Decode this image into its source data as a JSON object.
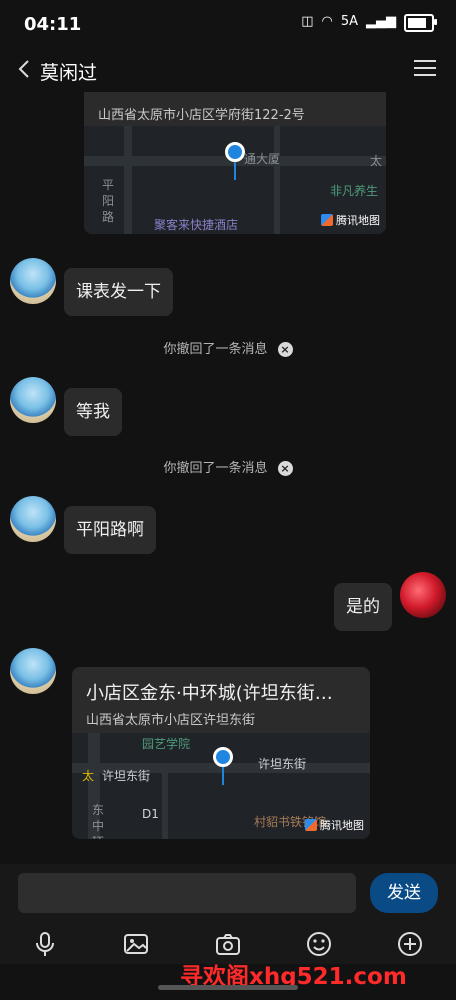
{
  "status_bar": {
    "time": "04:11",
    "network": "5A",
    "battery_level": 0.7
  },
  "header": {
    "title": "莫闲过"
  },
  "messages": {
    "map1": {
      "address": "山西省太原市小店区学府街122-2号",
      "labels": [
        "平",
        "阳",
        "路",
        "通大厦",
        "非凡养生",
        "太",
        "聚客来快捷酒店"
      ],
      "provider": "腾讯地图"
    },
    "m1": "课表发一下",
    "notice1": "你撤回了一条消息",
    "m2": "等我",
    "notice2": "你撤回了一条消息",
    "m3": "平阳路啊",
    "m4": "是的",
    "map2": {
      "title": "小店区金东·中环城(许坦东街…",
      "address": "山西省太原市小店区许坦东街",
      "labels": [
        "园艺学院",
        "许坦东街",
        "许坦东街",
        "太",
        "东",
        "中",
        "环",
        "D1",
        "村貂书铁铭馆"
      ],
      "provider": "腾讯地图"
    }
  },
  "input": {
    "placeholder": "",
    "send_label": "发送"
  },
  "toolbar": {
    "icons": [
      "microphone-icon",
      "image-icon",
      "camera-icon",
      "emoji-icon",
      "plus-icon"
    ]
  },
  "watermark": "寻欢阁xhg521.com",
  "colors": {
    "send_button": "#0a4a85",
    "pin": "#1f86e0",
    "watermark": "#ff2a2a"
  }
}
